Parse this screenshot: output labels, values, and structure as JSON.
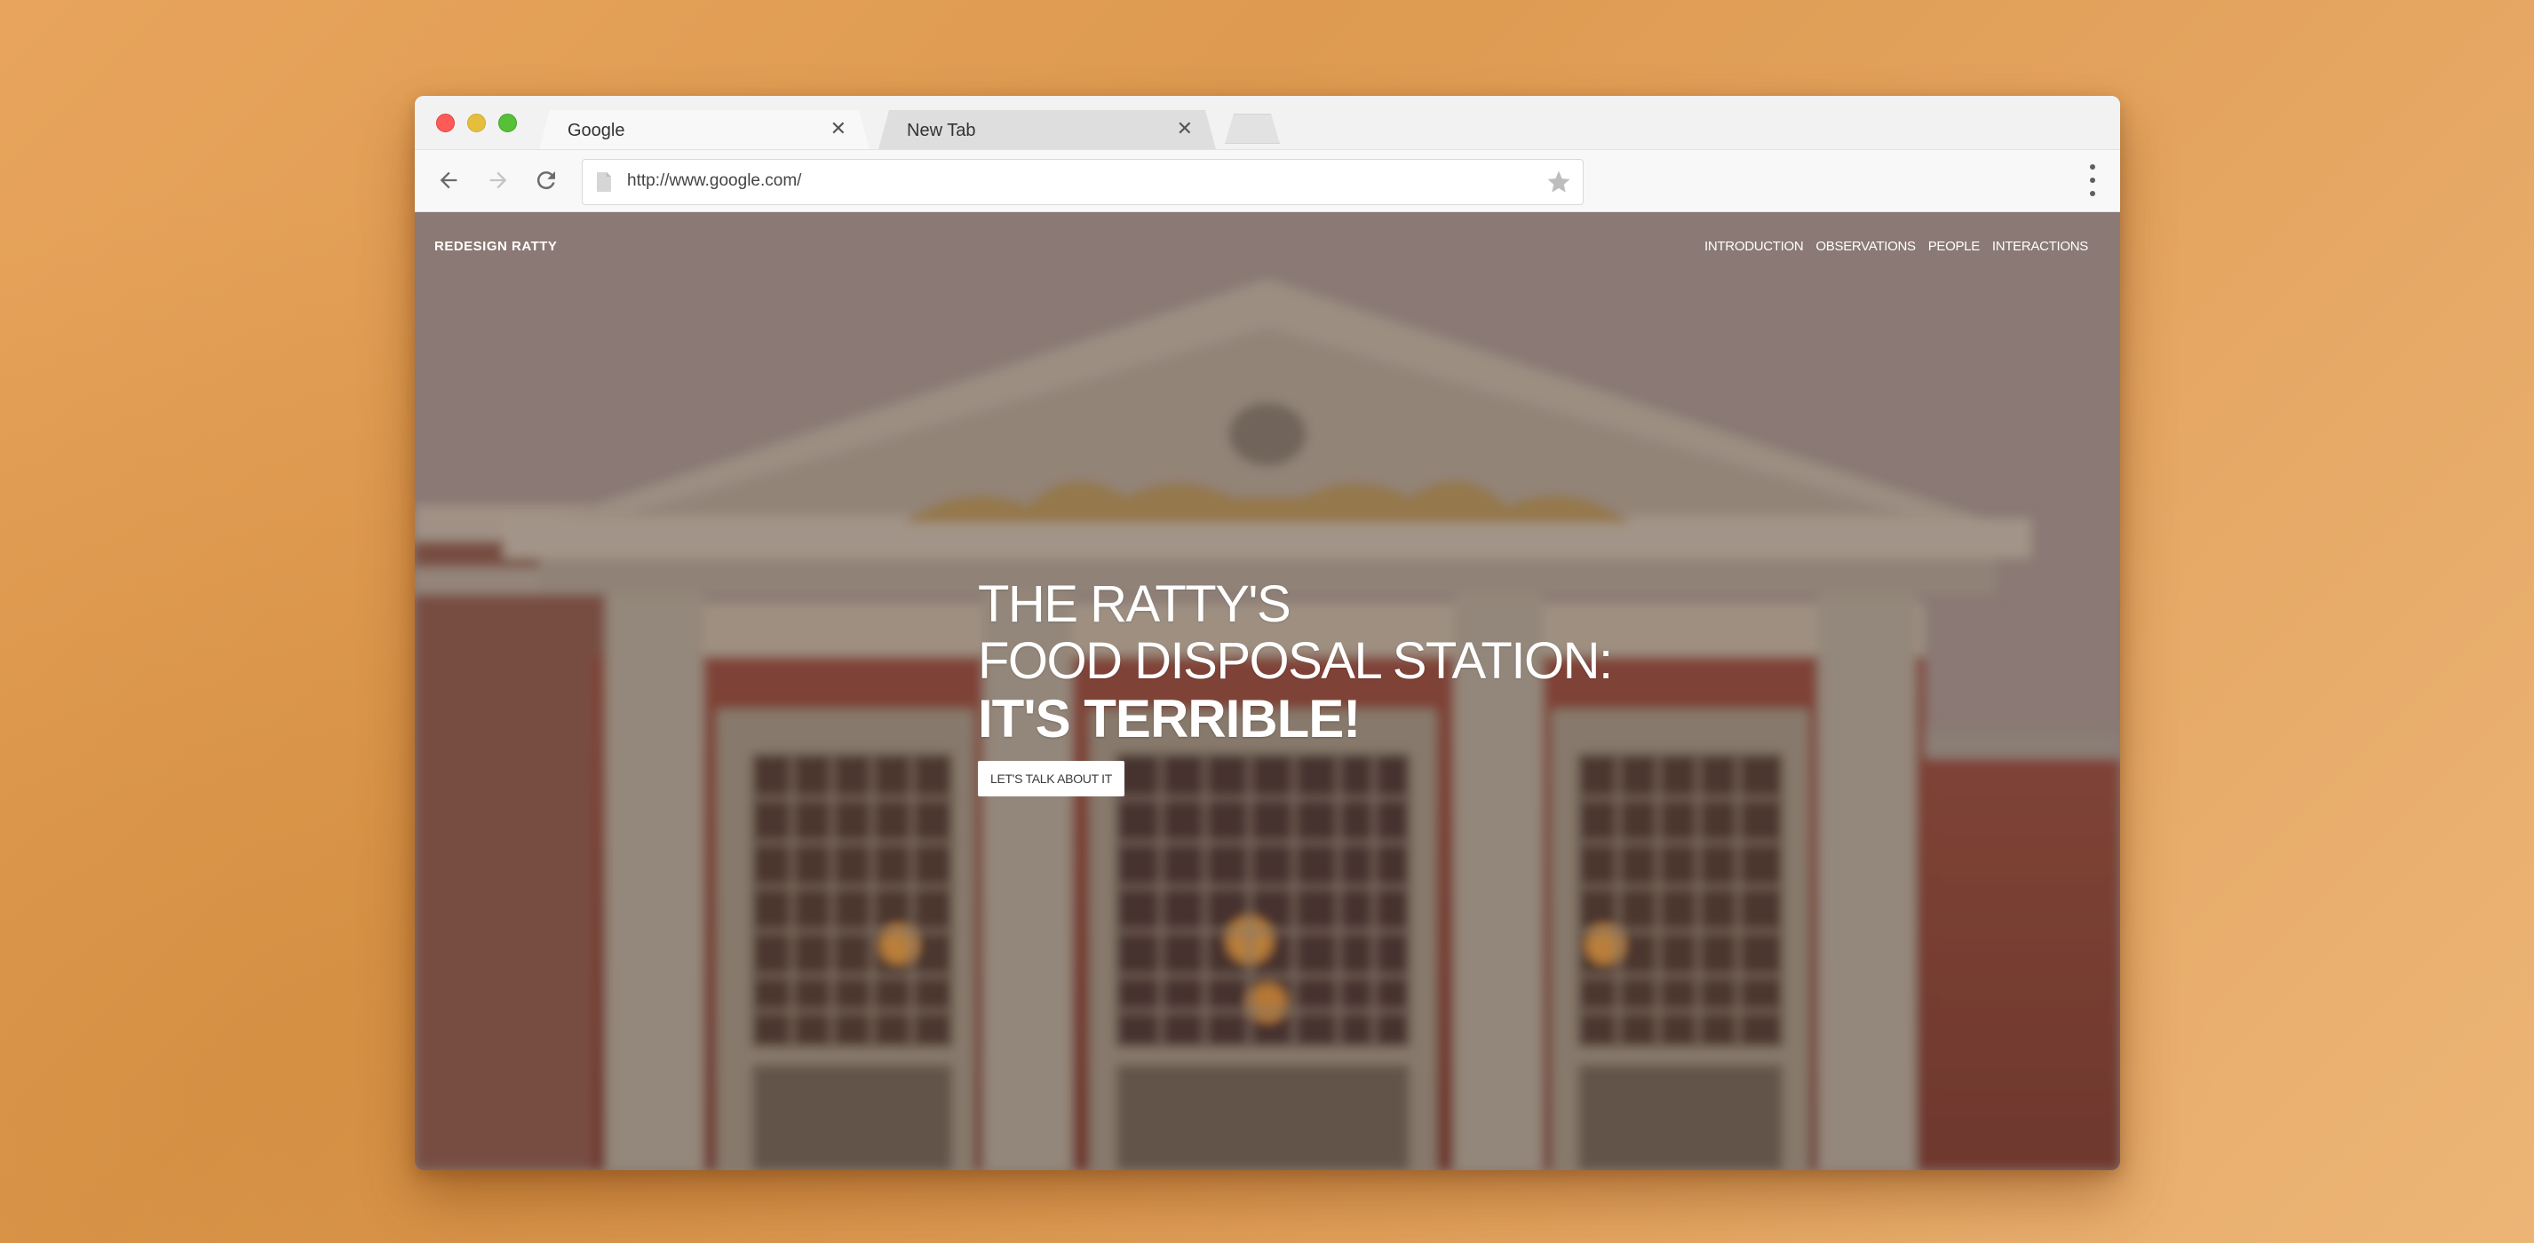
{
  "browser": {
    "tabs": [
      {
        "label": "Google",
        "active": true
      },
      {
        "label": "New Tab",
        "active": false
      }
    ],
    "close_glyph": "✕",
    "url": "http://www.google.com/"
  },
  "site": {
    "brand": "REDESIGN RATTY",
    "nav": [
      "INTRODUCTION",
      "OBSERVATIONS",
      "PEOPLE",
      "INTERACTIONS"
    ],
    "hero": {
      "line1": "THE RATTY'S",
      "line2": "FOOD DISPOSAL STATION:",
      "line3": "IT'S TERRIBLE!",
      "cta": "LET'S TALK ABOUT IT"
    }
  },
  "colors": {
    "background": "#e2a25e",
    "traffic_red": "#fc5b57",
    "traffic_yellow": "#e5bf3c",
    "traffic_green": "#57c038"
  }
}
